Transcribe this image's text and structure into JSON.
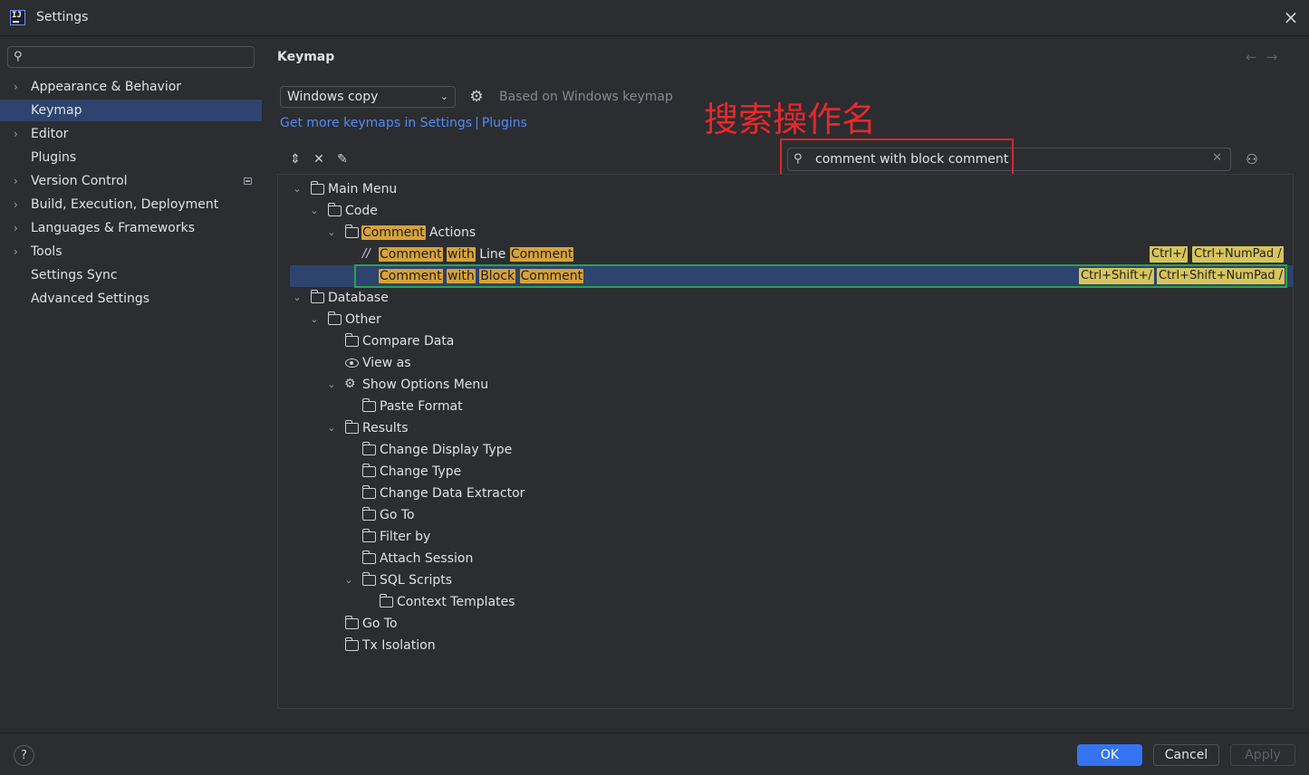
{
  "window": {
    "title": "Settings",
    "app_icon": "intellij-icon",
    "close": "×"
  },
  "sidebar": {
    "search_value": "",
    "items": [
      {
        "label": "Appearance & Behavior",
        "expandable": true
      },
      {
        "label": "Keymap",
        "selected": true
      },
      {
        "label": "Editor",
        "expandable": true
      },
      {
        "label": "Plugins"
      },
      {
        "label": "Version Control",
        "expandable": true,
        "badge": true
      },
      {
        "label": "Build, Execution, Deployment",
        "expandable": true
      },
      {
        "label": "Languages & Frameworks",
        "expandable": true
      },
      {
        "label": "Tools",
        "expandable": true
      },
      {
        "label": "Settings Sync"
      },
      {
        "label": "Advanced Settings"
      }
    ]
  },
  "main": {
    "title": "Keymap",
    "keymap_select": "Windows copy",
    "based_on": "Based on Windows keymap",
    "more_link_prefix": "Get more keymaps in Settings",
    "more_link_sep": "|",
    "more_link_plugins": "Plugins",
    "annotation": "搜索操作名",
    "search_value": "comment with block comment",
    "tree": {
      "main_menu": "Main Menu",
      "code": "Code",
      "comment_actions_hl": "Comment",
      "comment_actions_rest": " Actions",
      "line_comment": {
        "w1": "Comment",
        "w2": "with",
        "w3": " Line ",
        "w4": "Comment",
        "shortcut1": "Ctrl+/",
        "shortcut2": "Ctrl+NumPad /"
      },
      "block_comment": {
        "w1": "Comment",
        "w2": "with",
        "w3": "Block",
        "w4": "Comment",
        "shortcut1": "Ctrl+Shift+/",
        "shortcut2": "Ctrl+Shift+NumPad /"
      },
      "database": "Database",
      "other": "Other",
      "compare_data": "Compare Data",
      "view_as": "View as",
      "show_options_menu": "Show Options Menu",
      "paste_format": "Paste Format",
      "results": "Results",
      "change_display_type": "Change Display Type",
      "change_type": "Change Type",
      "change_data_extractor": "Change Data Extractor",
      "go_to_results": "Go To",
      "filter_by": "Filter by",
      "attach_session": "Attach Session",
      "sql_scripts": "SQL Scripts",
      "context_templates": "Context Templates",
      "go_to": "Go To",
      "tx_isolation": "Tx Isolation"
    }
  },
  "footer": {
    "help": "?",
    "ok": "OK",
    "cancel": "Cancel",
    "apply": "Apply"
  },
  "colors": {
    "accent": "#3574f0",
    "selection": "#2e436e",
    "highlight": "#d7a23a",
    "annotation_red": "#e8282a",
    "green_box": "#2aa34a"
  }
}
